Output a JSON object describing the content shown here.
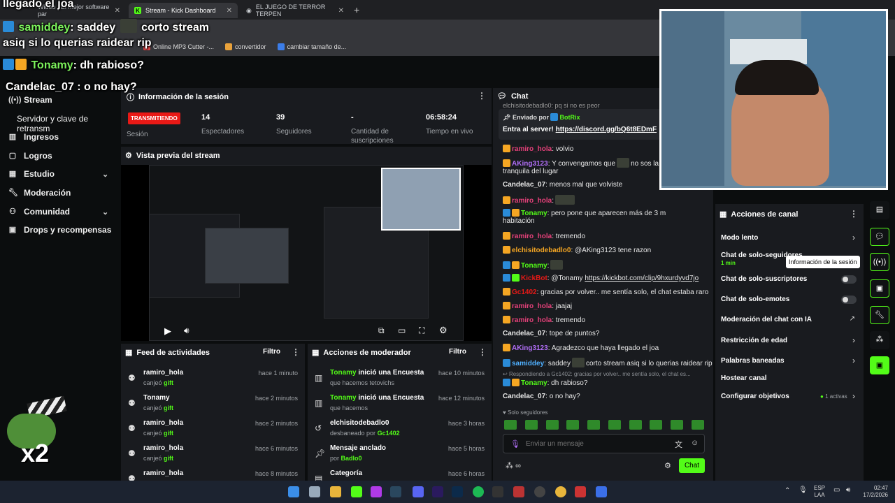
{
  "browser": {
    "tabs": [
      {
        "label": "Wideo | El mejor software par"
      },
      {
        "label": "Stream - Kick Dashboard"
      },
      {
        "label": "EL JUEGO DE TERROR TERPEN"
      }
    ],
    "bookmarks": [
      "Online MP3 Cutter -...",
      "convertidor",
      "cambiar tamaño de..."
    ]
  },
  "overlay": {
    "line1": "llegado el joa",
    "line2_user": "samiddey",
    "line2_text": ": saddey",
    "line2_after": "corto stream",
    "line3": "asiq si lo querias raidear rip",
    "line4_user": "Tonamy",
    "line4_text": ": dh rabioso?",
    "line5": "Candelac_07 : o no hay?",
    "x2": "x2"
  },
  "sidebar": {
    "items": [
      {
        "label": "Stream",
        "icon": "broadcast-icon"
      },
      {
        "label": "Servidor y clave de retransm"
      },
      {
        "label": "Ingresos",
        "icon": "chart-icon"
      },
      {
        "label": "Logros",
        "icon": "trophy-icon"
      },
      {
        "label": "Estudio",
        "icon": "grid-icon"
      },
      {
        "label": "Moderación",
        "icon": "wrench-icon"
      },
      {
        "label": "Comunidad",
        "icon": "people-icon"
      },
      {
        "label": "Drops y recompensas",
        "icon": "gift-icon"
      }
    ]
  },
  "session": {
    "title": "Información de la sesión",
    "badge": "TRANSMITIENDO",
    "badge_label": "Sesión",
    "stats": [
      {
        "value": "14",
        "label": "Espectadores"
      },
      {
        "value": "39",
        "label": "Seguidores"
      },
      {
        "value": "-",
        "label": "Cantidad de suscripciones"
      },
      {
        "value": "06:58:24",
        "label": "Tiempo en vivo"
      }
    ]
  },
  "preview": {
    "title": "Vista previa del stream"
  },
  "activity": {
    "title": "Feed de actividades",
    "filter": "Filtro",
    "rows": [
      {
        "name": "ramiro_hola",
        "action": "canjeó",
        "item": "gift",
        "time": "hace 1 minuto"
      },
      {
        "name": "Tonamy",
        "action": "canjeó",
        "item": "gift",
        "time": "hace 2 minutos"
      },
      {
        "name": "ramiro_hola",
        "action": "canjeó",
        "item": "gift",
        "time": "hace 2 minutos"
      },
      {
        "name": "ramiro_hola",
        "action": "canjeó",
        "item": "gift",
        "time": "hace 6 minutos"
      },
      {
        "name": "ramiro_hola",
        "action": "",
        "item": "",
        "time": "hace 8 minutos"
      }
    ]
  },
  "modactions": {
    "title": "Acciones de moderador",
    "filter": "Filtro",
    "rows": [
      {
        "name": "Tonamy",
        "action": " inició una Encuesta",
        "sub": "que hacemos tetovichs",
        "time": "hace 10 minutos"
      },
      {
        "name": "Tonamy",
        "action": " inició una Encuesta",
        "sub": "que hacemos",
        "time": "hace 12 minutos"
      },
      {
        "name": "elchisitodebadlo0",
        "action": "",
        "sub": "desbaneado por",
        "subuser": "Gc1402",
        "time": "hace 3 horas"
      },
      {
        "name": "Mensaje anclado",
        "action": "",
        "sub": "por",
        "subuser": "Badlo0",
        "time": "hace 5 horas"
      },
      {
        "name": "Categoría",
        "action": "",
        "sub": "",
        "time": "hace 6 horas"
      }
    ]
  },
  "chat": {
    "title": "Chat",
    "pinned_top": "elchisitodebadlo0: pq si no es peor",
    "pinned_sent_by": "Enviado por",
    "pinned_user": "BotRix",
    "pinned_text": "Entra al server!",
    "pinned_link": "https://discord.gg/bQ6t8EDmF",
    "messages": [
      {
        "user": "ramiro_hola",
        "color": "#e6417a",
        "text": ": volvio"
      },
      {
        "user": "AKing3123",
        "color": "#b06ef5",
        "text": ": Y convengamos que",
        "text2": "no sos la pe",
        "line2": "tranquila del lugar"
      },
      {
        "user": "Candelac_07",
        "color": "#e8e8e8",
        "text": ": menos mal que volviste"
      },
      {
        "user": "ramiro_hola",
        "color": "#e6417a",
        "text": ":"
      },
      {
        "user": "Tonamy",
        "color": "#53fc18",
        "text": ": pero pone que aparecen más de 3 m",
        "line2": "habitación"
      },
      {
        "user": "ramiro_hola",
        "color": "#e6417a",
        "text": ": tremendo"
      },
      {
        "user": "elchisitodebadlo0",
        "color": "#f5a623",
        "text": ": @AKing3123 tene razon"
      },
      {
        "user": "Tonamy",
        "color": "#53fc18",
        "text": ":"
      },
      {
        "user": "KickBot",
        "color": "#e91916",
        "text": ": @Tonamy",
        "link": "https://kickbot.com/clip/9hxurdyvd7jo"
      },
      {
        "user": "Gc1402",
        "color": "#e91916",
        "text": ": gracias por volver.. me sentía solo, el chat estaba raro"
      },
      {
        "user": "ramiro_hola",
        "color": "#e6417a",
        "text": ": jaajaj"
      },
      {
        "user": "ramiro_hola",
        "color": "#e6417a",
        "text": ": tremendo"
      },
      {
        "user": "Candelac_07",
        "color": "#e8e8e8",
        "text": ": tope de puntos?"
      },
      {
        "user": "AKing3123",
        "color": "#b06ef5",
        "text": ": Agradezco que haya llegado el joa"
      },
      {
        "user": "samiddey",
        "color": "#4fb0ff",
        "text": ": saddey",
        "text2": "corto stream asiq si lo querias raidear rip"
      },
      {
        "user": "Tonamy",
        "color": "#53fc18",
        "text": ": dh rabioso?",
        "reply": "Respondiendo a Gc1402: gracias por volver.. me sentía solo, el chat es..."
      },
      {
        "user": "Candelac_07",
        "color": "#e8e8e8",
        "text": ": o no hay?"
      }
    ],
    "followers_only": "Solo seguidores",
    "input_placeholder": "Enviar un mensaje",
    "send_label": "Chat",
    "points": "∞"
  },
  "channel_actions": {
    "title": "Acciones de canal",
    "items": [
      {
        "label": "Modo lento",
        "kind": "arrow"
      },
      {
        "label": "Chat de solo-seguidores",
        "sub": "1 min",
        "kind": "arrow"
      },
      {
        "label": "Chat de solo-suscriptores",
        "kind": "toggle"
      },
      {
        "label": "Chat de solo-emotes",
        "kind": "toggle"
      },
      {
        "label": "Moderación del chat con IA",
        "kind": "external"
      },
      {
        "label": "Restricción de edad",
        "kind": "arrow"
      },
      {
        "label": "Palabras baneadas",
        "kind": "arrow"
      },
      {
        "label": "Hostear canal",
        "kind": "none"
      },
      {
        "label": "Configurar objetivos",
        "extra": "1 activas",
        "kind": "arrow"
      }
    ]
  },
  "tooltip": "Información de la sesión",
  "taskbar": {
    "lang": "ESP",
    "lang2": "LAA",
    "time": "02:47",
    "date": "17/2/2026"
  },
  "colors": {
    "accent": "#53fc18",
    "live": "#e91916",
    "panel": "#191b1f",
    "bg": "#0b0d0e"
  }
}
